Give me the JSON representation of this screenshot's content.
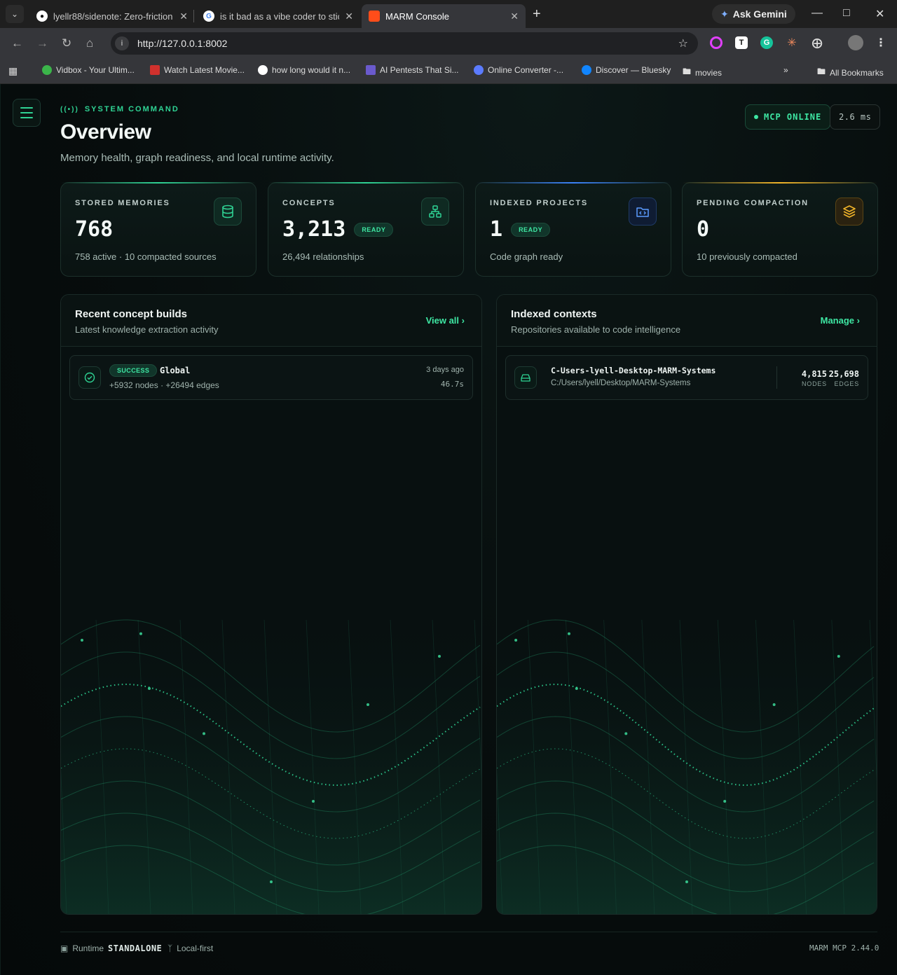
{
  "browser": {
    "tabs": [
      {
        "title": "lyellr88/sidenote: Zero-friction",
        "icon": "github-icon"
      },
      {
        "title": "is it bad as a vibe coder to stick",
        "icon": "google-icon"
      },
      {
        "title": "MARM Console",
        "icon": "marm-icon",
        "active": true
      }
    ],
    "ask_gemini": "Ask Gemini",
    "url": "http://127.0.0.1:8002",
    "bookmarks": [
      {
        "label": "Vidbox - Your Ultim...",
        "color": "#3bb54a"
      },
      {
        "label": "Watch Latest Movie...",
        "color": "#d0312d"
      },
      {
        "label": "how long would it n...",
        "color": "#4285f4"
      },
      {
        "label": "AI Pentests That Si...",
        "color": "#6a5acd"
      },
      {
        "label": "Online Converter -...",
        "color": "#5b7bff"
      },
      {
        "label": "Discover — Bluesky",
        "color": "#1185fe"
      },
      {
        "label": "movies",
        "color": "folder"
      }
    ],
    "all_bookmarks": "All Bookmarks"
  },
  "header": {
    "eyebrow": "SYSTEM COMMAND",
    "title": "Overview",
    "subtitle": "Memory health, graph readiness, and local runtime activity.",
    "status": "MCP ONLINE",
    "latency": "2.6 ms"
  },
  "stats": [
    {
      "label": "STORED MEMORIES",
      "value": "768",
      "badge": "",
      "sub": "758 active · 10 compacted sources",
      "accent": "#2fd394",
      "icon": "database-icon"
    },
    {
      "label": "CONCEPTS",
      "value": "3,213",
      "badge": "READY",
      "sub": "26,494 relationships",
      "accent": "#2fd394",
      "icon": "network-icon"
    },
    {
      "label": "INDEXED PROJECTS",
      "value": "1",
      "badge": "READY",
      "sub": "Code graph ready",
      "accent": "#3b82f6",
      "icon": "code-folder-icon"
    },
    {
      "label": "PENDING COMPACTION",
      "value": "0",
      "badge": "",
      "sub": "10 previously compacted",
      "accent": "#f0b429",
      "icon": "layers-icon"
    }
  ],
  "builds": {
    "title": "Recent concept builds",
    "subtitle": "Latest knowledge extraction activity",
    "link": "View all",
    "items": [
      {
        "status": "SUCCESS",
        "name": "Global",
        "meta": "+5932 nodes · +26494 edges",
        "time": "3 days ago",
        "duration": "46.7s"
      }
    ]
  },
  "contexts": {
    "title": "Indexed contexts",
    "subtitle": "Repositories available to code intelligence",
    "link": "Manage",
    "items": [
      {
        "name": "C-Users-lyell-Desktop-MARM-Systems",
        "path": "C:/Users/lyell/Desktop/MARM-Systems",
        "nodes": "4,815",
        "nodes_label": "NODES",
        "edges": "25,698",
        "edges_label": "EDGES"
      }
    ]
  },
  "footer": {
    "runtime_label": "Runtime",
    "runtime_value": "STANDALONE",
    "mode": "Local-first",
    "version": "MARM MCP 2.44.0"
  },
  "colors": {
    "accent": "#2fd394",
    "blue": "#3b82f6",
    "amber": "#f0b429"
  }
}
